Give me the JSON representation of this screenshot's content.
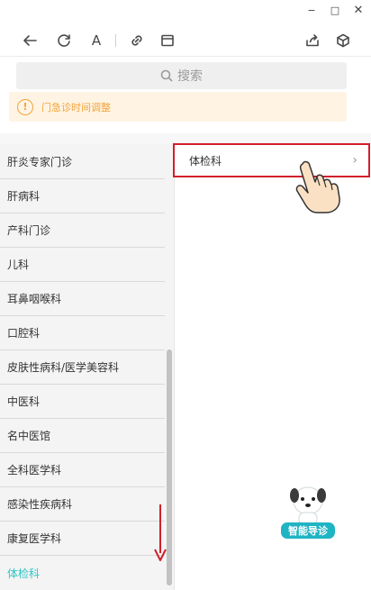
{
  "window": {
    "minimize": "−",
    "maximize": "□",
    "close": "✕"
  },
  "toolbar": {
    "back_icon": "arrow-left-icon",
    "refresh_icon": "refresh-icon",
    "font_label": "A",
    "link_icon": "link-icon",
    "layout_icon": "window-icon",
    "share_icon": "share-icon",
    "box_icon": "cube-icon"
  },
  "search": {
    "placeholder": "搜索"
  },
  "notice": {
    "icon": "!",
    "text": "门急诊时间调整"
  },
  "left_menu": {
    "items": [
      "肝炎专家门诊",
      "肝病科",
      "产科门诊",
      "儿科",
      "耳鼻咽喉科",
      "口腔科",
      "皮肤性病科/医学美容科",
      "中医科",
      "名中医馆",
      "全科医学科",
      "感染性疾病科",
      "康复医学科",
      "体检科"
    ],
    "active_item": "体检科"
  },
  "right_list": {
    "items": [
      {
        "label": "体检科",
        "chevron": "›"
      }
    ]
  },
  "mascot": {
    "label": "智能导诊"
  },
  "colors": {
    "active": "#2fc4c4",
    "highlight_box": "#d21f2a",
    "notice_text": "#f2a33a",
    "notice_bg": "#fff4e3"
  }
}
